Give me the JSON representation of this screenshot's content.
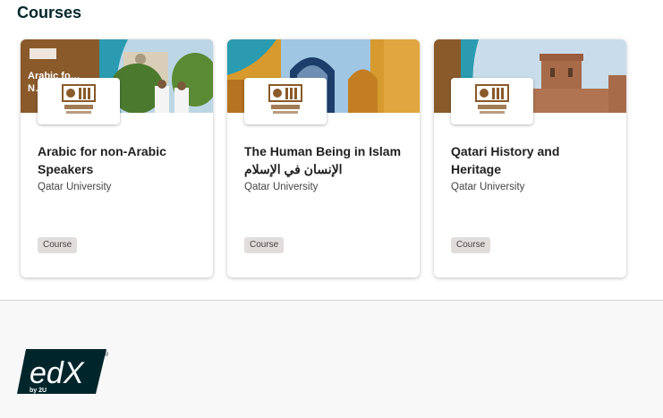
{
  "section": {
    "title": "Courses"
  },
  "courses": [
    {
      "title": "Arabic for non-Arabic Speakers",
      "org": "Qatar University",
      "badge": "Course",
      "banner_text": "Arabic fo… N… S…"
    },
    {
      "title": "The Human Being in Islam الإنسان في الإسلام",
      "org": "Qatar University",
      "badge": "Course"
    },
    {
      "title": "Qatari History and Heritage",
      "org": "Qatar University",
      "badge": "Course"
    }
  ],
  "org_logo": {
    "arabic": "جامعة قطر",
    "english": "QATAR UNIVERSITY"
  },
  "footer": {
    "brand": "edX",
    "sub": "by 2U",
    "mark": "®"
  },
  "colors": {
    "title": "#00262b",
    "badge_bg": "#e1dddb",
    "brand_dark": "#00262b",
    "qu_gold": "#8a5a2b",
    "footer_bg": "#f8f8f8"
  }
}
